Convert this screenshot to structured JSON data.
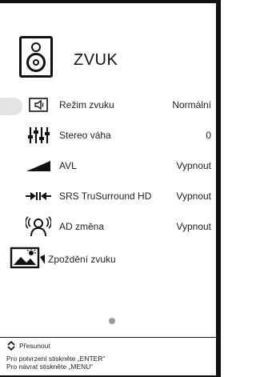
{
  "screen": {
    "title": "ZVUK",
    "title_icon": "speaker-icon"
  },
  "menu": {
    "items": [
      {
        "label": "Režim zvuku",
        "value": "Normální",
        "icon": "sound-mode-icon",
        "selected": true
      },
      {
        "label": "Stereo váha",
        "value": "0",
        "icon": "balance-icon",
        "selected": false
      },
      {
        "label": "AVL",
        "value": "Vypnout",
        "icon": "avl-icon",
        "selected": false
      },
      {
        "label": "SRS TruSurround HD",
        "value": "Vypnout",
        "icon": "srs-icon",
        "selected": false
      },
      {
        "label": "AD změna",
        "value": "Vypnout",
        "icon": "audio-description-icon",
        "selected": false
      },
      {
        "label": "Zpoždění zvuku",
        "value": "",
        "icon": "audio-delay-icon",
        "selected": false
      }
    ]
  },
  "footer": {
    "move_label": "Přesunout",
    "confirm_hint": "Pro potvrzení stiskněte „ENTER“",
    "back_hint": "Pro návrat stiskněte „MENU“"
  }
}
